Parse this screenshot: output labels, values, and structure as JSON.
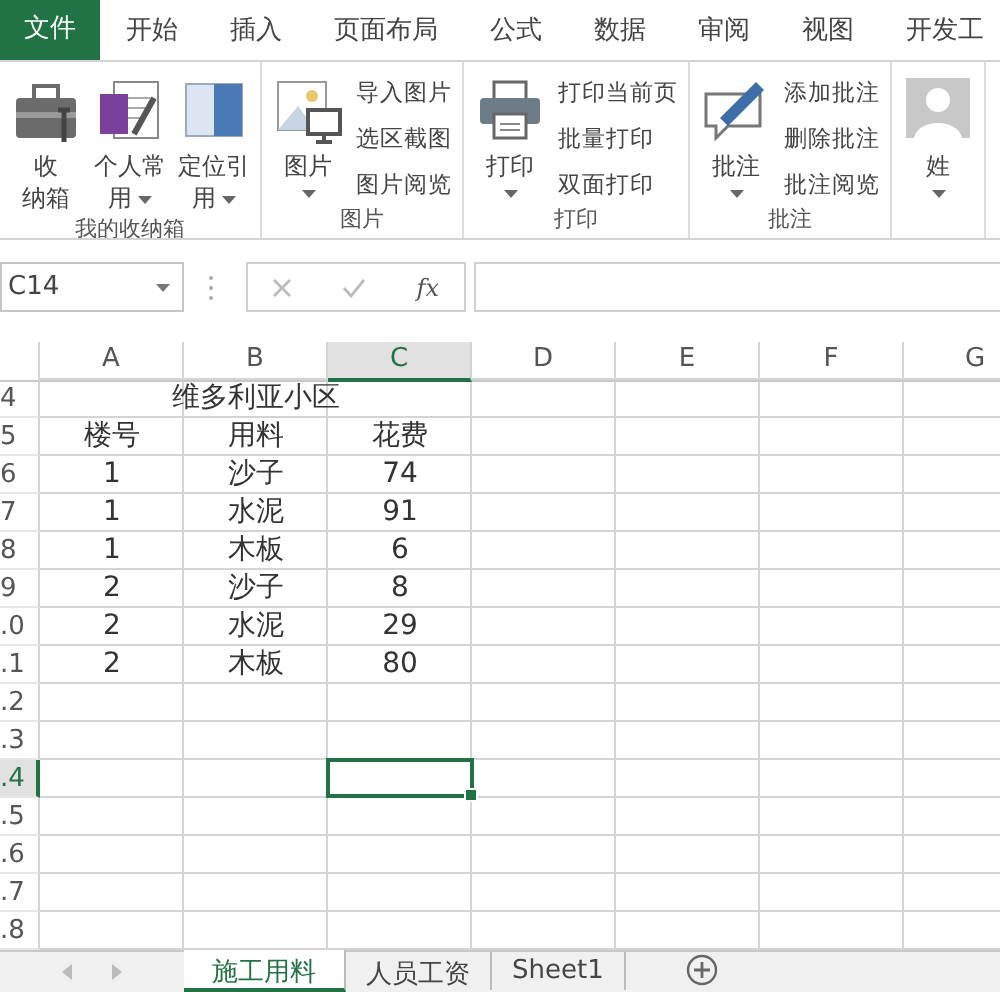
{
  "menu_tabs": [
    {
      "label": "文件",
      "kind": "file",
      "selected": true
    },
    {
      "label": "开始",
      "kind": "tab",
      "selected": false
    },
    {
      "label": "插入",
      "kind": "tab",
      "selected": false
    },
    {
      "label": "页面布局",
      "kind": "tab",
      "selected": false
    },
    {
      "label": "公式",
      "kind": "tab",
      "selected": false
    },
    {
      "label": "数据",
      "kind": "tab",
      "selected": false
    },
    {
      "label": "审阅",
      "kind": "tab",
      "selected": false
    },
    {
      "label": "视图",
      "kind": "tab",
      "selected": false
    },
    {
      "label": "开发工",
      "kind": "tab",
      "selected": false
    }
  ],
  "ribbon_groups": [
    {
      "label": "我的收纳箱",
      "large_buttons": [
        {
          "lines": [
            "收",
            "纳箱"
          ],
          "dropdown": false
        },
        {
          "lines": [
            "个人常",
            "用"
          ],
          "dropdown": true
        },
        {
          "lines": [
            "定位引",
            "用"
          ],
          "dropdown": true
        }
      ]
    },
    {
      "label": "图片",
      "large_buttons": [
        {
          "lines": [
            "图片"
          ],
          "dropdown": true
        }
      ],
      "small_buttons": [
        "导入图片",
        "选区截图",
        "图片阅览"
      ]
    },
    {
      "label": "打印",
      "large_buttons": [
        {
          "lines": [
            "打印"
          ],
          "dropdown": true
        }
      ],
      "small_buttons": [
        "打印当前页",
        "批量打印",
        "双面打印"
      ]
    },
    {
      "label": "批注",
      "large_buttons": [
        {
          "lines": [
            "批注"
          ],
          "dropdown": true
        }
      ],
      "small_buttons": [
        "添加批注",
        "删除批注",
        "批注阅览"
      ]
    },
    {
      "large_buttons": [
        {
          "lines": [
            "姓"
          ],
          "dropdown": true
        }
      ]
    }
  ],
  "formula_bar": {
    "name_box": "C14",
    "function_label": "fx"
  },
  "sheet": {
    "columns": [
      {
        "label": "A",
        "selected": false
      },
      {
        "label": "B",
        "selected": false
      },
      {
        "label": "C",
        "selected": true
      },
      {
        "label": "D",
        "selected": false
      },
      {
        "label": "E",
        "selected": false
      },
      {
        "label": "F",
        "selected": false
      },
      {
        "label": "G",
        "selected": false
      }
    ],
    "rows": [
      {
        "label": "4",
        "selected": false,
        "kind": "merged",
        "text": "维多利亚小区"
      },
      {
        "label": "5",
        "selected": false,
        "kind": "cells",
        "cells": [
          "楼号",
          "用料",
          "花费"
        ]
      },
      {
        "label": "6",
        "selected": false,
        "kind": "cells",
        "cells": [
          "1",
          "沙子",
          "74"
        ]
      },
      {
        "label": "7",
        "selected": false,
        "kind": "cells",
        "cells": [
          "1",
          "水泥",
          "91"
        ]
      },
      {
        "label": "8",
        "selected": false,
        "kind": "cells",
        "cells": [
          "1",
          "木板",
          "6"
        ]
      },
      {
        "label": "9",
        "selected": false,
        "kind": "cells",
        "cells": [
          "2",
          "沙子",
          "8"
        ]
      },
      {
        "label": ".0",
        "selected": false,
        "kind": "cells",
        "cells": [
          "2",
          "水泥",
          "29"
        ]
      },
      {
        "label": ".1",
        "selected": false,
        "kind": "cells",
        "cells": [
          "2",
          "木板",
          "80"
        ]
      },
      {
        "label": ".2",
        "selected": false,
        "kind": "empty"
      },
      {
        "label": ".3",
        "selected": false,
        "kind": "empty"
      },
      {
        "label": ".4",
        "selected": true,
        "kind": "empty"
      },
      {
        "label": ".5",
        "selected": false,
        "kind": "empty"
      },
      {
        "label": ".6",
        "selected": false,
        "kind": "empty"
      },
      {
        "label": ".7",
        "selected": false,
        "kind": "empty"
      },
      {
        "label": ".8",
        "selected": false,
        "kind": "empty"
      }
    ]
  },
  "sheet_tabs": [
    {
      "label": "施工用料",
      "selected": true
    },
    {
      "label": "人员工资",
      "selected": false
    },
    {
      "label": "Sheet1",
      "selected": false
    }
  ]
}
